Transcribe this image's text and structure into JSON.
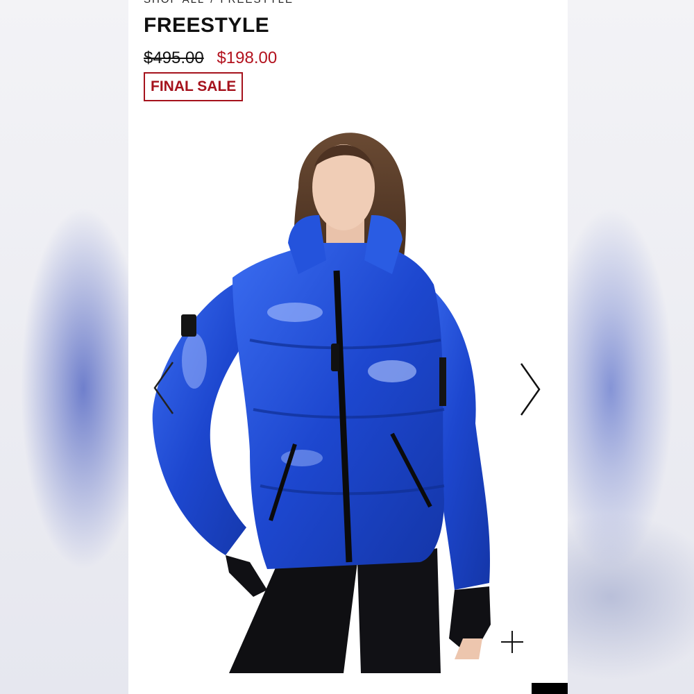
{
  "breadcrumb": {
    "items": [
      "SHOP ALL",
      "FREESTYLE"
    ],
    "separator": "/"
  },
  "product": {
    "title": "FREESTYLE",
    "price_original": "$495.00",
    "price_sale": "$198.00",
    "badge": "FINAL SALE"
  },
  "gallery": {
    "image_subject": "model wearing glossy cobalt blue puffer jacket with black zipper, black leggings",
    "prev_icon": "chevron-left-icon",
    "next_icon": "chevron-right-icon",
    "zoom_icon": "plus-icon"
  },
  "colors": {
    "sale_red": "#b3121e",
    "jacket_blue": "#1f4fd6",
    "text": "#111111"
  }
}
